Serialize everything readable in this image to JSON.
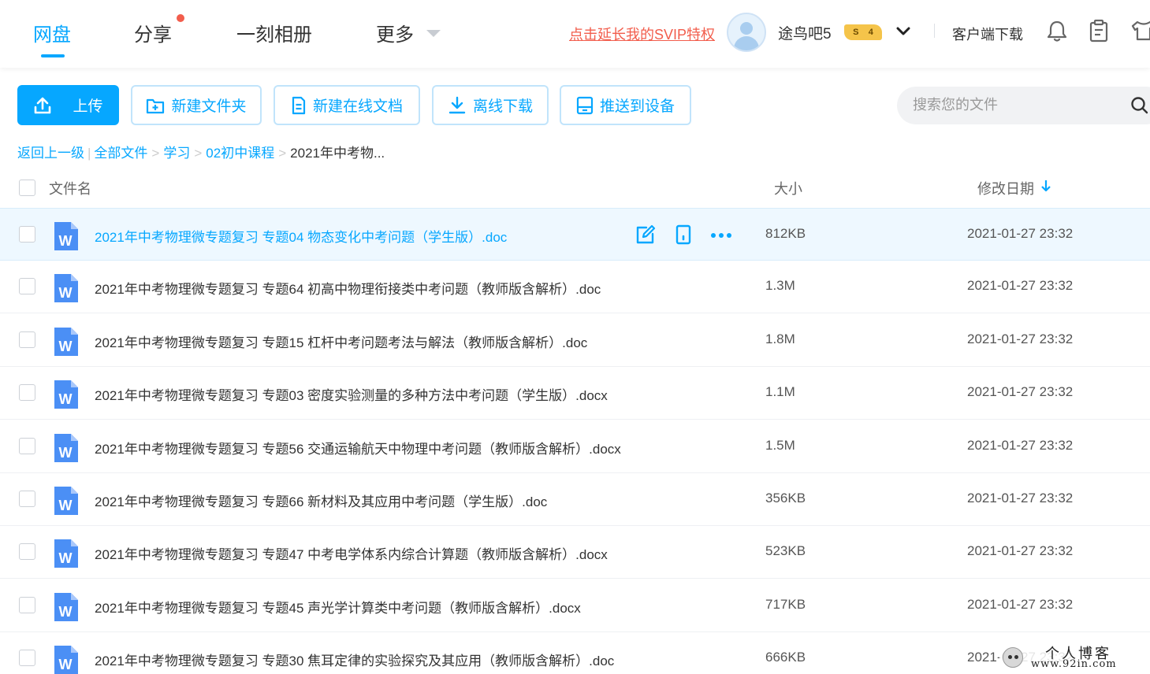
{
  "nav": {
    "tabs": [
      {
        "label": "网盘",
        "active": true
      },
      {
        "label": "分享",
        "has_notification_dot": true
      },
      {
        "label": "一刻相册"
      },
      {
        "label": "更多"
      }
    ],
    "svip_link": "点击延长我的SVIP特权",
    "username": "途鸟吧5",
    "svip_badge": {
      "symbol": "S",
      "level": "4"
    },
    "client_download": "客户端下载",
    "icons": [
      "bell-icon",
      "clipboard-icon",
      "shirt-icon"
    ]
  },
  "toolbar": {
    "upload": "上传",
    "new_folder": "新建文件夹",
    "new_online_doc": "新建在线文档",
    "offline_download": "离线下载",
    "push_to_device": "推送到设备"
  },
  "search": {
    "placeholder": "搜索您的文件"
  },
  "breadcrumb": {
    "back": "返回上一级",
    "items": [
      "全部文件",
      "学习",
      "02初中课程"
    ],
    "current": "2021年中考物..."
  },
  "table": {
    "columns": {
      "name": "文件名",
      "size": "大小",
      "date": "修改日期"
    },
    "sort": {
      "column": "date",
      "direction": "desc"
    },
    "rows": [
      {
        "name": "2021年中考物理微专题复习 专题04 物态变化中考问题（学生版）.doc",
        "size": "812KB",
        "date": "2021-01-27 23:32",
        "hovered": true
      },
      {
        "name": "2021年中考物理微专题复习 专题64 初高中物理衔接类中考问题（教师版含解析）.doc",
        "size": "1.3M",
        "date": "2021-01-27 23:32"
      },
      {
        "name": "2021年中考物理微专题复习 专题15 杠杆中考问题考法与解法（教师版含解析）.doc",
        "size": "1.8M",
        "date": "2021-01-27 23:32"
      },
      {
        "name": "2021年中考物理微专题复习 专题03 密度实验测量的多种方法中考问题（学生版）.docx",
        "size": "1.1M",
        "date": "2021-01-27 23:32"
      },
      {
        "name": "2021年中考物理微专题复习 专题56 交通运输航天中物理中考问题（教师版含解析）.docx",
        "size": "1.5M",
        "date": "2021-01-27 23:32"
      },
      {
        "name": "2021年中考物理微专题复习 专题66 新材料及其应用中考问题（学生版）.doc",
        "size": "356KB",
        "date": "2021-01-27 23:32"
      },
      {
        "name": "2021年中考物理微专题复习 专题47 中考电学体系内综合计算题（教师版含解析）.docx",
        "size": "523KB",
        "date": "2021-01-27 23:32"
      },
      {
        "name": "2021年中考物理微专题复习 专题45 声光学计算类中考问题（教师版含解析）.docx",
        "size": "717KB",
        "date": "2021-01-27 23:32"
      },
      {
        "name": "2021年中考物理微专题复习 专题30 焦耳定律的实验探究及其应用（教师版含解析）.doc",
        "size": "666KB",
        "date": "2021-01-27 23:32"
      }
    ]
  },
  "watermark": {
    "title": "个人博客",
    "url": "www.92in.com"
  },
  "colors": {
    "accent": "#06a7ff",
    "svip_red": "#f25d4c",
    "badge_gold": "#f5c44a",
    "word_blue": "#4b8ff5",
    "row_hover": "#eef8ff"
  }
}
